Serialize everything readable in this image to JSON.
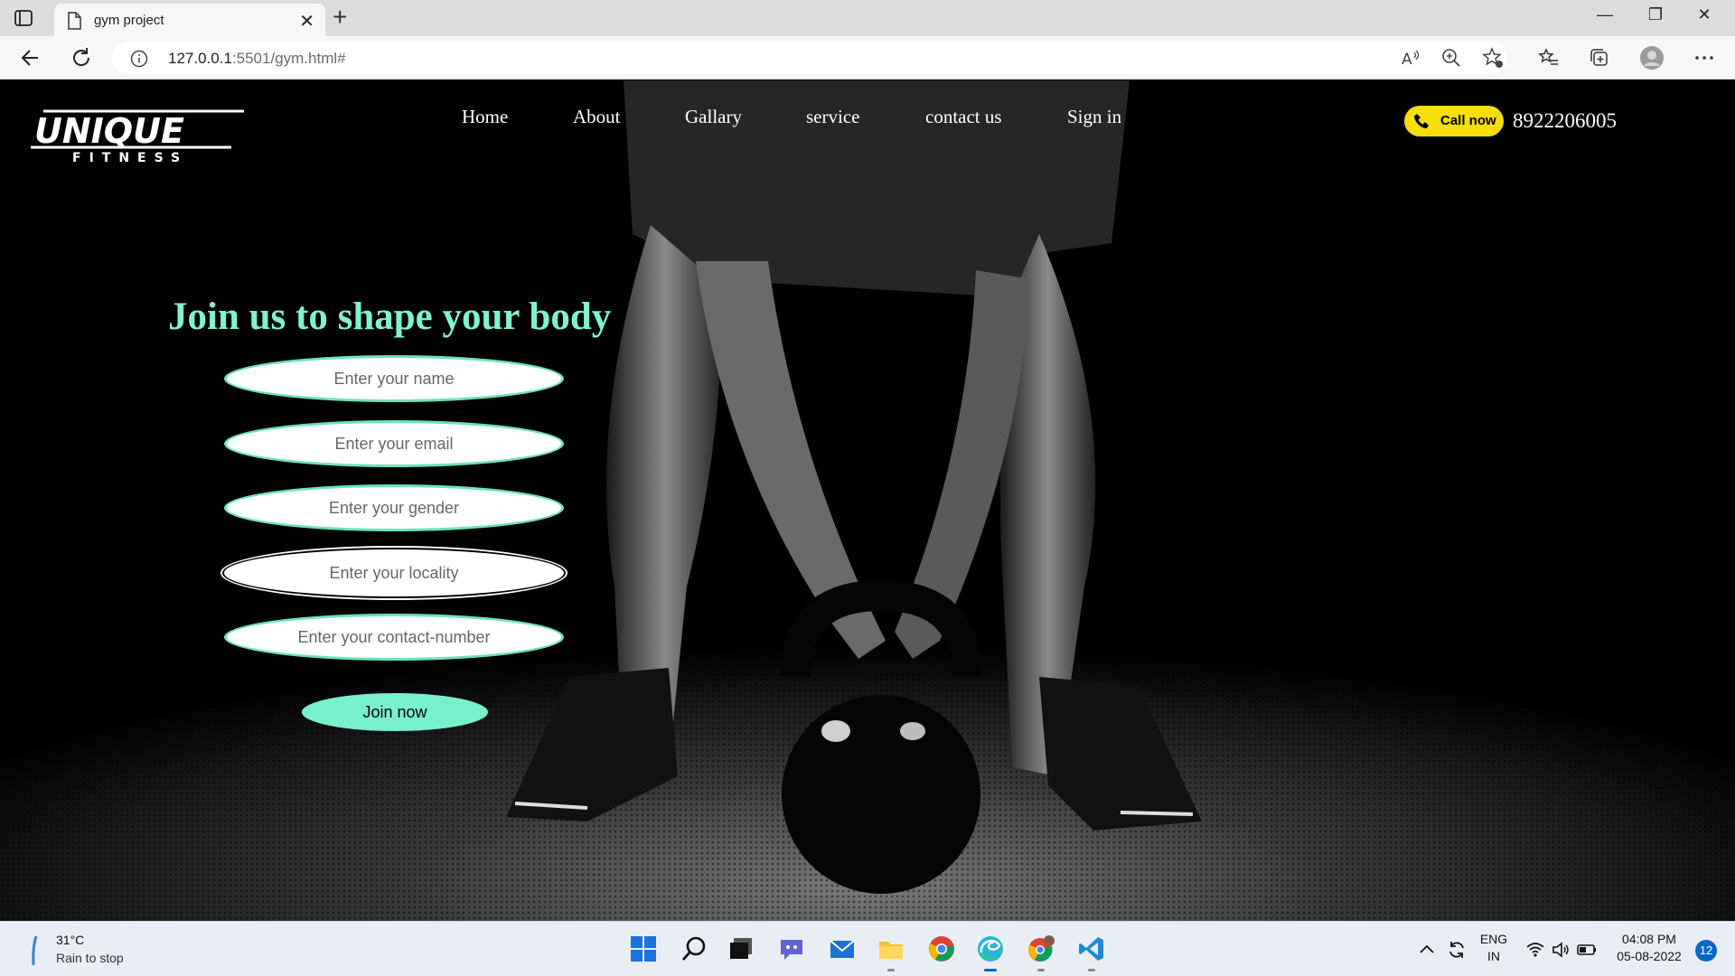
{
  "browser": {
    "tab_title": "gym project",
    "url_host": "127.0.0.1",
    "url_rest": ":5501/gym.html#"
  },
  "site": {
    "logo": {
      "brand": "UNIQUE",
      "sub": "FITNESS"
    },
    "nav": [
      "Home",
      "About",
      "Gallary",
      "service",
      "contact us",
      "Sign in"
    ],
    "call_label": "Call now",
    "phone": "8922206005",
    "headline": "Join us to shape your body",
    "form": {
      "placeholders": [
        "Enter your name",
        "Enter your email",
        "Enter your gender",
        "Enter your locality",
        "Enter your contact-number"
      ],
      "submit": "Join now"
    },
    "colors": {
      "accent": "#7ff3cf",
      "call_button": "#f7dd0a"
    }
  },
  "taskbar": {
    "weather_temp": "31°C",
    "weather_text": "Rain to stop",
    "lang": "ENG",
    "region": "IN",
    "time": "04:08 PM",
    "date": "05-08-2022",
    "notifications": "12",
    "apps": [
      "start-icon",
      "search-icon",
      "task-view-icon",
      "teams-chat-icon",
      "mail-icon",
      "file-explorer-icon",
      "chrome-icon",
      "edge-icon",
      "chrome-profile-icon",
      "vscode-icon"
    ]
  }
}
